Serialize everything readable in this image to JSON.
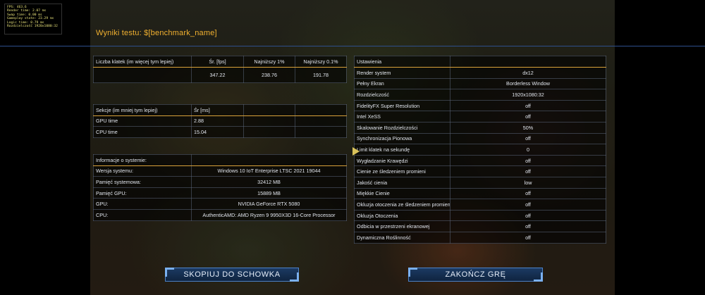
{
  "overlay": {
    "lines": [
      "FPS: 463.6",
      "Render time: 2.07 ms",
      "Swap time: 0.00 ms",
      "Gameplay state: 23.29 ms",
      "Logic time: 0.79 ms",
      "Rozdzielczość 1920x1080:32"
    ]
  },
  "header": {
    "title": "Wyniki testu: $[benchmark_name]"
  },
  "fps_table": {
    "headers": [
      "Liczba klatek (im więcej tym lepiej)",
      "Śr. [fps]",
      "Najniższy 1%",
      "Najniższy 0.1%"
    ],
    "values": [
      "",
      "347.22",
      "238.76",
      "191.78"
    ]
  },
  "sections_table": {
    "headers": [
      "Sekcje (im mniej tym lepiej)",
      "Śr [ms]",
      "",
      ""
    ],
    "rows": [
      [
        "GPU time",
        "2.88",
        "",
        ""
      ],
      [
        "CPU time",
        "15.04",
        "",
        ""
      ]
    ]
  },
  "system_info": {
    "header": "Informacje o systemie:",
    "rows": [
      [
        "Wersja systemu:",
        "Windows 10 IoT Enterprise LTSC 2021 19044"
      ],
      [
        "Pamięć systemowa:",
        "32412 MB"
      ],
      [
        "Pamięć GPU:",
        "15889 MB"
      ],
      [
        "GPU:",
        "NVIDIA GeForce RTX 5080"
      ],
      [
        "CPU:",
        "AuthenticAMD: AMD Ryzen 9 9950X3D 16-Core Processor"
      ]
    ]
  },
  "settings": {
    "header": "Ustawienia",
    "rows": [
      [
        "Render system",
        "dx12"
      ],
      [
        "Pełny Ekran",
        "Borderless Window"
      ],
      [
        "Rozdzielczość",
        "1920x1080:32"
      ],
      [
        "FidelityFX Super Resolution",
        "off"
      ],
      [
        "Intel XeSS",
        "off"
      ],
      [
        "Skalowanie Rozdzielczości",
        "50%"
      ],
      [
        "Synchronizacja Pionowa",
        "off"
      ],
      [
        "Limit klatek na sekundę",
        "0"
      ],
      [
        "Wygładzanie Krawędzi",
        "off"
      ],
      [
        "Cienie ze śledzeniem promieni",
        "off"
      ],
      [
        "Jakość cienia",
        "low"
      ],
      [
        "Miękkie Cienie",
        "off"
      ],
      [
        "Okluzja otoczenia ze śledzeniem promieni",
        "off"
      ],
      [
        "Okluzja Otoczenia",
        "off"
      ],
      [
        "Odbicia w przestrzeni ekranowej",
        "off"
      ],
      [
        "Dynamiczna Roślinność",
        "off"
      ]
    ]
  },
  "buttons": {
    "copy": "SKOPIUJ DO SCHOWKA",
    "quit": "ZAKOŃCZ GRĘ"
  }
}
